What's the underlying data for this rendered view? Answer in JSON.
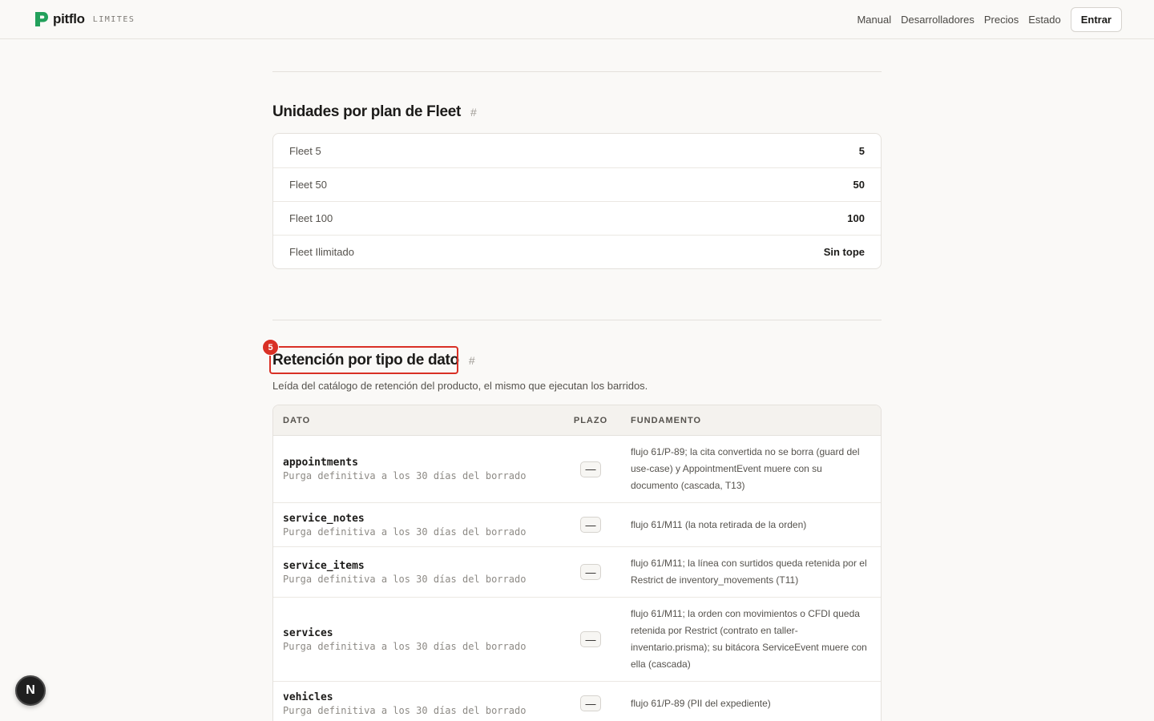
{
  "header": {
    "brand": "pitflo",
    "tag": "LIMITES",
    "nav": [
      "Manual",
      "Desarrolladores",
      "Precios",
      "Estado"
    ],
    "enter_label": "Entrar"
  },
  "fleet_section": {
    "title": "Unidades por plan de Fleet",
    "hash": "#",
    "rows": [
      {
        "label": "Fleet 5",
        "value": "5"
      },
      {
        "label": "Fleet 50",
        "value": "50"
      },
      {
        "label": "Fleet 100",
        "value": "100"
      },
      {
        "label": "Fleet Ilimitado",
        "value": "Sin tope"
      }
    ]
  },
  "retention_section": {
    "badge": "5",
    "title": "Retención por tipo de dato",
    "hash": "#",
    "description": "Leída del catálogo de retención del producto, el mismo que ejecutan los barridos.",
    "columns": [
      "DATO",
      "PLAZO",
      "FUNDAMENTO"
    ],
    "rows": [
      {
        "name": "appointments",
        "sub": "Purga definitiva a los 30 días del borrado",
        "term": "—",
        "basis": "flujo 61/P-89; la cita convertida no se borra (guard del use-case) y AppointmentEvent muere con su documento (cascada, T13)"
      },
      {
        "name": "service_notes",
        "sub": "Purga definitiva a los 30 días del borrado",
        "term": "—",
        "basis": "flujo 61/M11 (la nota retirada de la orden)"
      },
      {
        "name": "service_items",
        "sub": "Purga definitiva a los 30 días del borrado",
        "term": "—",
        "basis": "flujo 61/M11; la línea con surtidos queda retenida por el Restrict de inventory_movements (T11)"
      },
      {
        "name": "services",
        "sub": "Purga definitiva a los 30 días del borrado",
        "term": "—",
        "basis": "flujo 61/M11; la orden con movimientos o CFDI queda retenida por Restrict (contrato en taller-inventario.prisma); su bitácora ServiceEvent muere con ella (cascada)"
      },
      {
        "name": "vehicles",
        "sub": "Purga definitiva a los 30 días del borrado",
        "term": "—",
        "basis": "flujo 61/P-89 (PII del expediente)"
      }
    ]
  },
  "fab_label": "N"
}
